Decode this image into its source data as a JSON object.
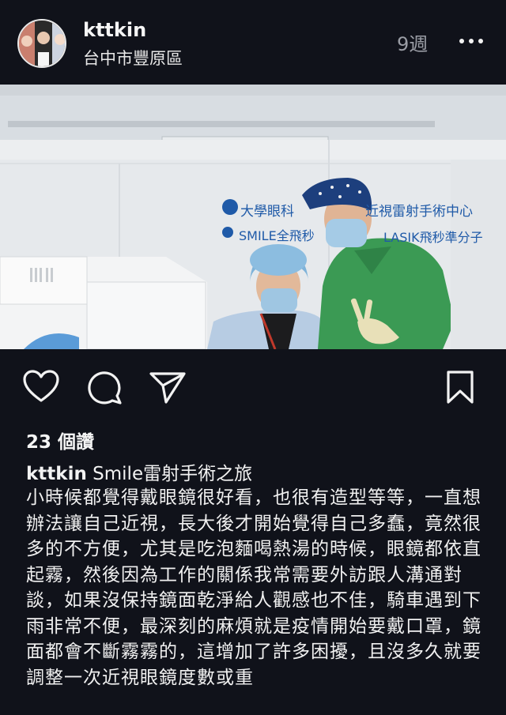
{
  "post": {
    "username": "kttkin",
    "location": "台中市豐原區",
    "time_ago": "9週",
    "likes": "23 個讚",
    "caption_title": "Smile雷射手術之旅",
    "caption_body": "小時候都覺得戴眼鏡很好看，也很有造型等等，一直想辦法讓自己近視，長大後才開始覺得自己多蠢，竟然很多的不方便，尤其是吃泡麵喝熱湯的時候，眼鏡都依直起霧，然後因為工作的關係我常需要外訪跟人溝通對談，如果沒保持鏡面乾淨給人觀感也不佳，騎車遇到下雨非常不便，最深刻的麻煩就是疫情開始要戴口罩，鏡面都會不斷霧霧的，這增加了許多困擾，且沒多久就要調整一次近視眼鏡度數或重"
  },
  "photo": {
    "sign_line1": "大學眼科",
    "sign_line1b": "近視雷射手術中心",
    "sign_line2": "SMILE全飛秒",
    "sign_line2b": "LASIK飛秒準分子"
  },
  "icons": {
    "like": "heart-icon",
    "comment": "comment-icon",
    "share": "send-icon",
    "save": "bookmark-icon",
    "more": "more-icon"
  }
}
